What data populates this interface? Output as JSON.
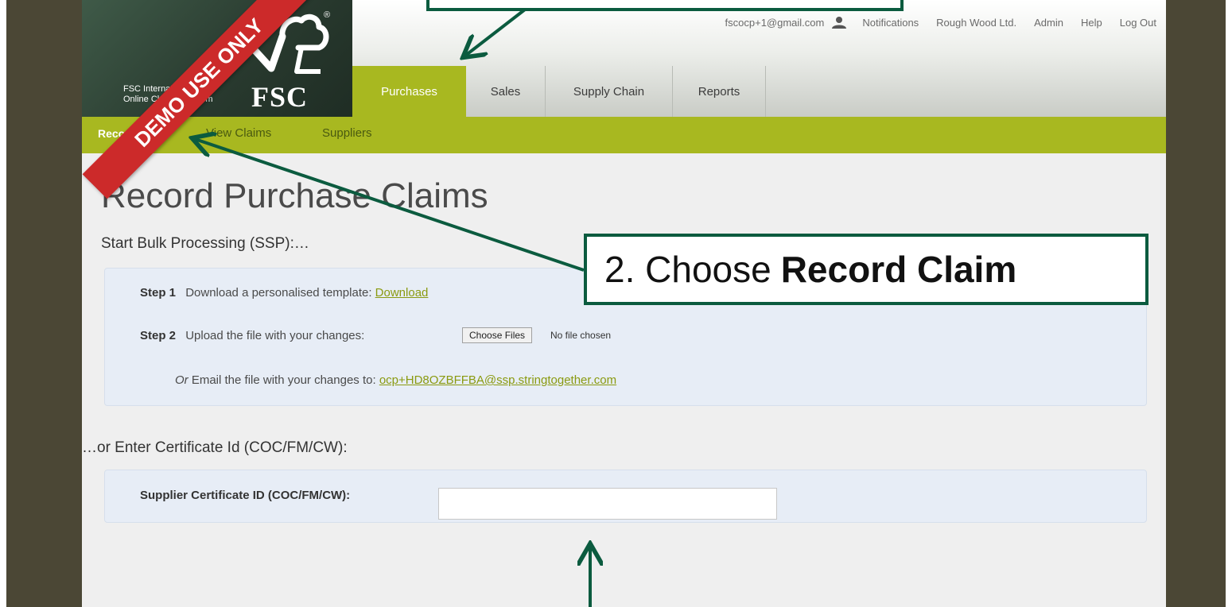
{
  "branding": {
    "platform_line1": "FSC International",
    "platform_line2": "Online Claims Platform",
    "logo_text": "FSC",
    "registered_mark": "®",
    "ribbon": "DEMO USE ONLY"
  },
  "top_links": {
    "email": "fscocp+1@gmail.com",
    "notifications": "Notifications",
    "company": "Rough Wood Ltd.",
    "admin": "Admin",
    "help": "Help",
    "logout": "Log Out",
    "user_icon": "user-icon"
  },
  "tabs": [
    {
      "label": "Purchases",
      "active": true
    },
    {
      "label": "Sales",
      "active": false
    },
    {
      "label": "Supply Chain",
      "active": false
    },
    {
      "label": "Reports",
      "active": false
    }
  ],
  "subnav": [
    {
      "label": "Record Claim",
      "active": true
    },
    {
      "label": "View Claims",
      "active": false
    },
    {
      "label": "Suppliers",
      "active": false
    }
  ],
  "main": {
    "title": "Record Purchase Claims",
    "bulk_title": "Start Bulk Processing (SSP):…",
    "step1_label": "Step 1",
    "step1_text": "Download a personalised template:",
    "step1_link": "Download",
    "step2_label": "Step 2",
    "step2_text": "Upload the file with your changes:",
    "file_button": "Choose Files",
    "file_status": "No file chosen",
    "or_prefix": "Or",
    "email_text": "Email the file with your changes to:",
    "email_link": "ocp+HD8OZBFFBA@ssp.stringtogether.com",
    "cert_title": "…or Enter Certificate Id (COC/FM/CW):",
    "cert_label": "Supplier Certificate ID (COC/FM/CW):",
    "cert_value": ""
  },
  "annotation": {
    "callout_prefix": "2. Choose",
    "callout_bold": "Record Claim"
  },
  "colors": {
    "accent_green": "#a8b820",
    "frame_dark": "#4b4735",
    "callout_border": "#0b5b3f",
    "ribbon_red": "#cc2a2a"
  }
}
